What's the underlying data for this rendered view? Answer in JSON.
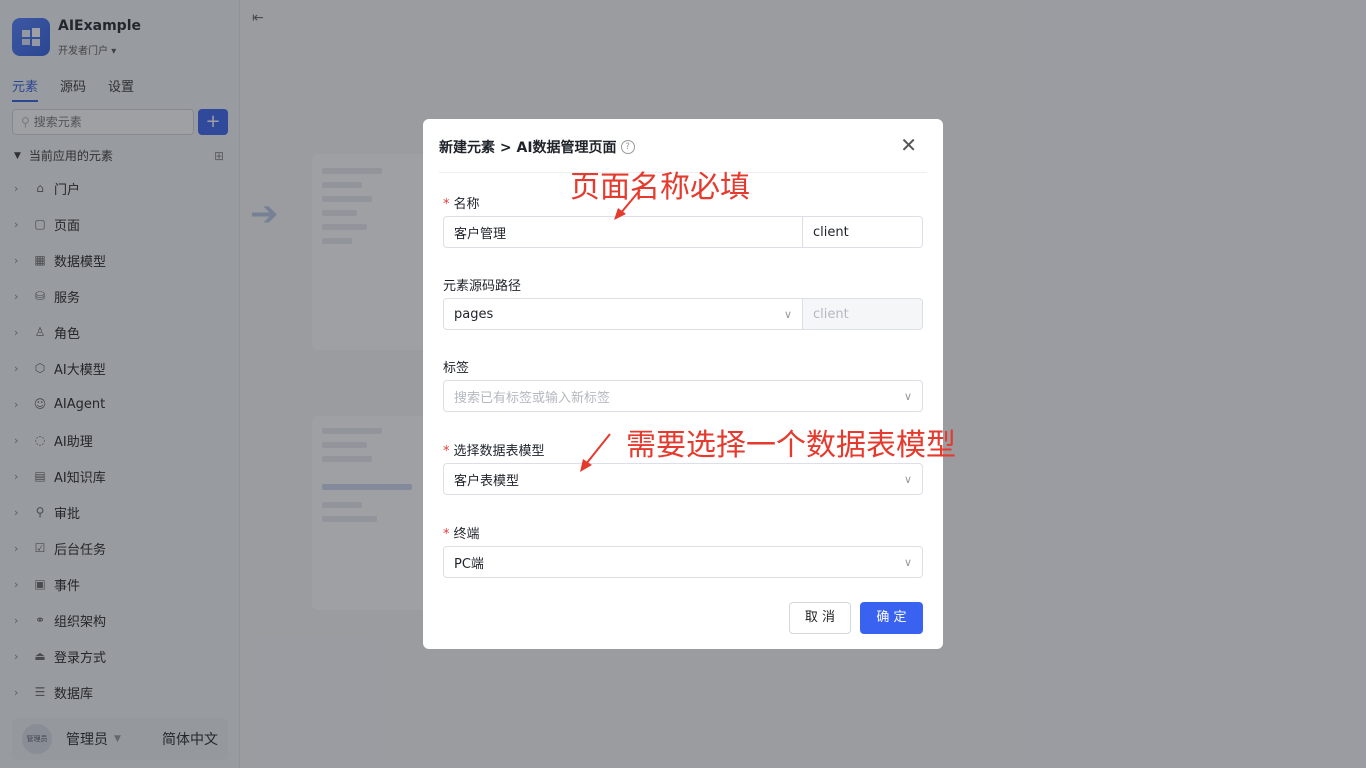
{
  "app": {
    "name": "AIExample",
    "portal": "开发者门户"
  },
  "tabs": [
    {
      "label": "元素",
      "active": true
    },
    {
      "label": "源码",
      "active": false
    },
    {
      "label": "设置",
      "active": false
    }
  ],
  "search": {
    "placeholder": "搜索元素",
    "add_label": "+"
  },
  "section": {
    "title": "当前应用的元素"
  },
  "nav": [
    {
      "label": "门户",
      "icon": "home-icon",
      "glyph": "⌂"
    },
    {
      "label": "页面",
      "icon": "page-icon",
      "glyph": "▢"
    },
    {
      "label": "数据模型",
      "icon": "table-icon",
      "glyph": "▦"
    },
    {
      "label": "服务",
      "icon": "service-icon",
      "glyph": "⛁"
    },
    {
      "label": "角色",
      "icon": "role-icon",
      "glyph": "♙"
    },
    {
      "label": "AI大模型",
      "icon": "ai-model-icon",
      "glyph": "⬡"
    },
    {
      "label": "AIAgent",
      "icon": "robot-icon",
      "glyph": "☺"
    },
    {
      "label": "AI助理",
      "icon": "ai-assistant-icon",
      "glyph": "◌"
    },
    {
      "label": "AI知识库",
      "icon": "knowledge-icon",
      "glyph": "▤"
    },
    {
      "label": "审批",
      "icon": "approve-icon",
      "glyph": "⚲"
    },
    {
      "label": "后台任务",
      "icon": "task-icon",
      "glyph": "☑"
    },
    {
      "label": "事件",
      "icon": "event-icon",
      "glyph": "▣"
    },
    {
      "label": "组织架构",
      "icon": "org-icon",
      "glyph": "⚭"
    },
    {
      "label": "登录方式",
      "icon": "login-icon",
      "glyph": "⏏"
    },
    {
      "label": "数据库",
      "icon": "database-icon",
      "glyph": "☰"
    }
  ],
  "user": {
    "name": "管理员",
    "avatar_text": "管理员",
    "language": "简体中文"
  },
  "modal": {
    "title": "新建元素 > AI数据管理页面",
    "name_label": "名称",
    "name_value": "客户管理",
    "name_suffix": "client",
    "path_label": "元素源码路径",
    "path_value": "pages",
    "path_suffix": "client",
    "tag_label": "标签",
    "tag_placeholder": "搜索已有标签或输入新标签",
    "model_label": "选择数据表模型",
    "model_value": "客户表模型",
    "terminal_label": "终端",
    "terminal_value": "PC端",
    "cancel": "取 消",
    "ok": "确 定"
  },
  "annotations": {
    "name_hint": "页面名称必填",
    "model_hint": "需要选择一个数据表模型"
  },
  "colors": {
    "primary": "#3a62f0",
    "annotation": "#e53a2e",
    "required": "#e23c39"
  }
}
